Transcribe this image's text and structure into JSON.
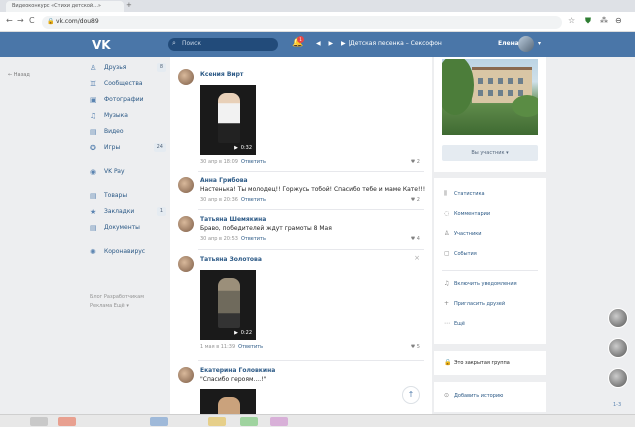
{
  "browser": {
    "tab_title": "Видеоконкурс «Стихи детской...»",
    "new_tab": "+",
    "back": "←",
    "forward": "→",
    "reload": "C",
    "url": "vk.com/dou89",
    "star": "☆",
    "ext1": "⛊",
    "ext2": "⁂",
    "ext3": "⊖"
  },
  "header": {
    "logo": "VK",
    "search_placeholder": "Поиск",
    "notifications_count": "1",
    "player_controls": "◀ ▶ ▶|",
    "track": "Детская песенка – Сексофон",
    "user_name": "Елена",
    "caret": "▾"
  },
  "left_back_link": "← Назад",
  "left_nav": [
    {
      "icon": "♙",
      "label": "Друзья",
      "count": "8"
    },
    {
      "icon": "♊",
      "label": "Сообщества",
      "count": ""
    },
    {
      "icon": "▣",
      "label": "Фотографии",
      "count": ""
    },
    {
      "icon": "♫",
      "label": "Музыка",
      "count": ""
    },
    {
      "icon": "▤",
      "label": "Видео",
      "count": ""
    },
    {
      "icon": "✪",
      "label": "Игры",
      "count": "24"
    }
  ],
  "left_nav2": [
    {
      "icon": "◉",
      "label": "VK Pay",
      "count": ""
    }
  ],
  "left_nav3": [
    {
      "icon": "▤",
      "label": "Товары",
      "count": ""
    },
    {
      "icon": "★",
      "label": "Закладки",
      "count": "1"
    },
    {
      "icon": "▤",
      "label": "Документы",
      "count": ""
    }
  ],
  "left_nav4": [
    {
      "icon": "✺",
      "label": "Коронавирус",
      "count": ""
    }
  ],
  "footer": {
    "line1": "Блог  Разработчикам",
    "line2": "Реклама  Ещё ▾"
  },
  "feed": {
    "posts": [
      {
        "name": "Ксения Вирт",
        "duration": "0:32",
        "date": "30 апр в 18:09",
        "reply": "Ответить",
        "likes": "♥ 2"
      },
      {
        "name": "Анна Грибова",
        "text": "Настенька! Ты молодец!! Горжусь тобой! Спасибо тебе и маме Кате!!!",
        "date": "30 апр в 20:36",
        "reply": "Ответить",
        "likes": "♥ 2"
      },
      {
        "name": "Татьяна Шемякина",
        "text": "Браво, победителей ждут грамоты 8 Мая",
        "date": "30 апр в 20:53",
        "reply": "Ответить",
        "likes": "♥ 4"
      },
      {
        "name": "Татьяна Золотова",
        "duration": "0:22",
        "date": "1 мая в 11:39",
        "reply": "Ответить",
        "likes": "♥ 5",
        "close": "×"
      },
      {
        "name": "Екатерина Головкина",
        "text": "\"Спасибо героям....!\""
      }
    ],
    "scroll_up": "↑"
  },
  "right": {
    "member_button": "Вы участник ▾",
    "menu": [
      {
        "icon": "⫼",
        "label": "Статистика"
      },
      {
        "icon": "◌",
        "label": "Комментарии"
      },
      {
        "icon": "♙",
        "label": "Участники"
      },
      {
        "icon": "▢",
        "label": "События"
      },
      {
        "icon": "♫",
        "label": "Включить уведомления"
      },
      {
        "icon": "+",
        "label": "Пригласить друзей"
      },
      {
        "icon": "⋯",
        "label": "Ещё"
      }
    ],
    "closed_group": "Это закрытая группа",
    "closed_icon": "🔒",
    "add_story": "Добавить историю",
    "story_icon": "⊙"
  },
  "floating_count": "1-3",
  "colors": {
    "vk_blue": "#4a76a8",
    "link": "#2a5885",
    "background": "#edeef0"
  }
}
